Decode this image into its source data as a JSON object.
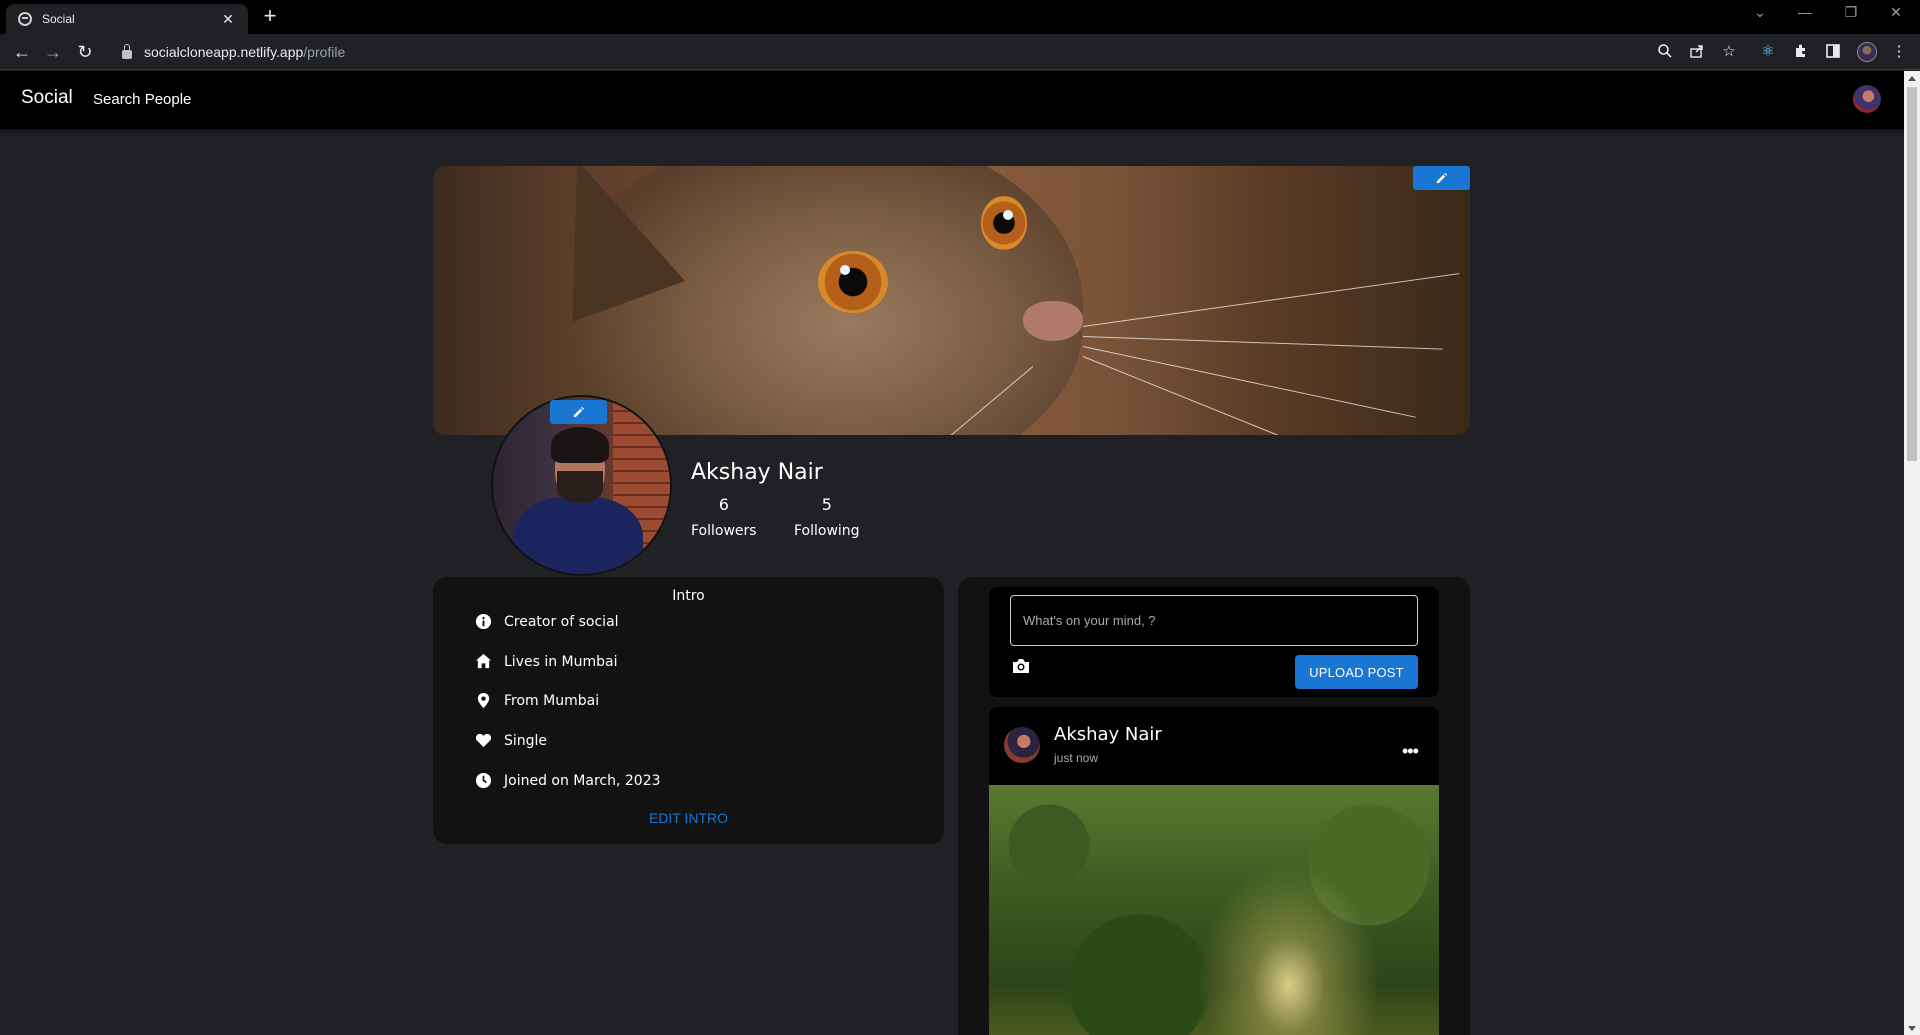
{
  "browser": {
    "tab_title": "Social",
    "tab_close": "✕",
    "new_tab": "+",
    "url_host": "socialcloneapp.netlify.app",
    "url_path": "/profile"
  },
  "app": {
    "brand": "Social",
    "nav_search": "Search People"
  },
  "profile": {
    "name": "Akshay Nair",
    "followers_count": "6",
    "followers_label": "Followers",
    "following_count": "5",
    "following_label": "Following"
  },
  "intro": {
    "title": "Intro",
    "items": [
      {
        "icon": "info-icon",
        "text": "Creator of social"
      },
      {
        "icon": "home-icon",
        "text": "Lives in Mumbai"
      },
      {
        "icon": "location-pin-icon",
        "text": "From Mumbai"
      },
      {
        "icon": "heart-icon",
        "text": "Single"
      },
      {
        "icon": "clock-icon",
        "text": "Joined on March, 2023"
      }
    ],
    "edit_label": "EDIT INTRO"
  },
  "composer": {
    "placeholder": "What's on your mind, ?",
    "upload_label": "UPLOAD POST"
  },
  "post": {
    "author": "Akshay Nair",
    "time": "just now",
    "more": "•••"
  },
  "colors": {
    "accent": "#1976d2",
    "page_bg": "#202124",
    "card_bg": "#121212",
    "bar_bg": "#000000"
  }
}
